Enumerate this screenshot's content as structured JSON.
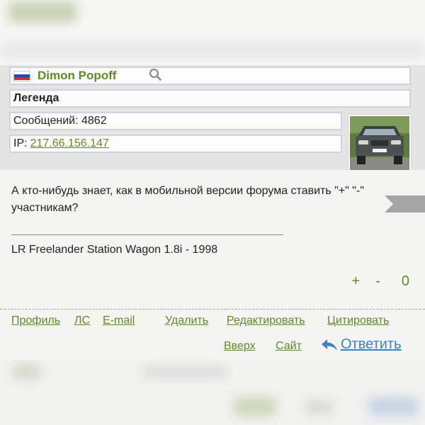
{
  "post": {
    "author": "Dimon Popoff",
    "country_flag": "russia-flag",
    "rank": "Легенда",
    "messages_label": "Сообщений: 4862",
    "ip_label": "IP:",
    "ip_value": "217.66.156.147",
    "avatar": "car-avatar",
    "text": "А кто-нибудь знает, как в мобильной версии форума ставить \"+\" \"-\" участникам?",
    "signature": "LR Freelander Station Wagon 1.8i - 1998",
    "rating": {
      "plus": "+",
      "minus": "-",
      "value": "0"
    }
  },
  "footer": {
    "profile": "Профиль",
    "pm": "ЛС",
    "email": "E-mail",
    "delete": "Удалить",
    "edit": "Редактировать",
    "quote": "Цитировать",
    "top": "Вверх",
    "site": "Сайт",
    "reply": "Ответить"
  },
  "colors": {
    "accent_green": "#5f8a2a",
    "link_blue": "#3b82c9",
    "row_border": "#cfd3e0"
  }
}
